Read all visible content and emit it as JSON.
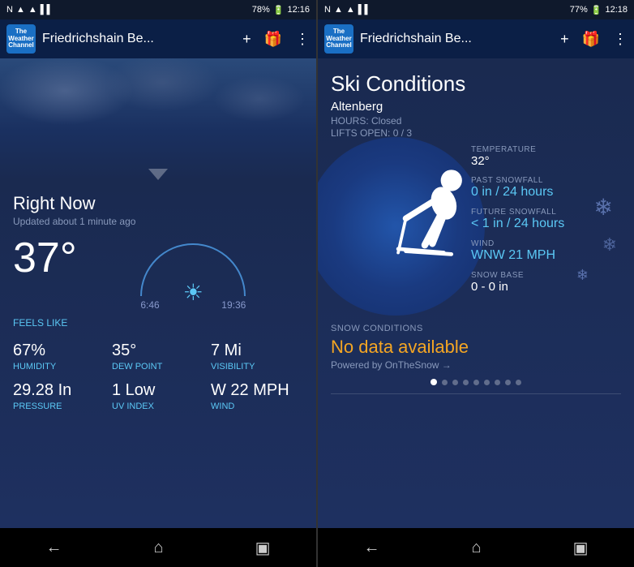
{
  "left_panel": {
    "status_bar": {
      "left_icons": [
        "NFC",
        "signal",
        "wifi",
        "signal-bars"
      ],
      "battery": "78%",
      "time": "12:16"
    },
    "app_bar": {
      "logo_line1": "The",
      "logo_line2": "Weather",
      "logo_line3": "Channel",
      "title": "Friedrichshain Be...",
      "add_icon": "+",
      "gift_icon": "🎁",
      "more_icon": "⋮"
    },
    "right_now": {
      "title": "Right Now",
      "updated": "Updated about 1 minute ago",
      "temperature": "37°",
      "feels_like": "FEELS LIKE",
      "sunrise": "6:46",
      "sunset": "19:36"
    },
    "stats": [
      {
        "value": "67%",
        "label": "HUMIDITY"
      },
      {
        "value": "35°",
        "label": "DEW POINT"
      },
      {
        "value": "7 Mi",
        "label": "VISIBILITY"
      },
      {
        "value": "29.28 In",
        "label": "PRESSURE"
      },
      {
        "value": "1 Low",
        "label": "UV INDEX"
      },
      {
        "value": "W 22 MPH",
        "label": "WIND"
      }
    ]
  },
  "right_panel": {
    "status_bar": {
      "battery": "77%",
      "time": "12:18"
    },
    "app_bar": {
      "logo_line1": "The",
      "logo_line2": "Weather",
      "logo_line3": "Channel",
      "title": "Friedrichshain Be...",
      "add_icon": "+",
      "gift_icon": "🎁",
      "more_icon": "⋮"
    },
    "ski": {
      "title": "Ski Conditions",
      "resort": "Altenberg",
      "hours_label": "HOURS:",
      "hours_value": "Closed",
      "lifts_label": "LIFTS OPEN:",
      "lifts_value": "0 / 3",
      "stats": [
        {
          "label": "TEMPERATURE",
          "value": "32°",
          "highlight": false
        },
        {
          "label": "PAST SNOWFALL",
          "value": "0 in / 24 hours",
          "highlight": true
        },
        {
          "label": "FUTURE SNOWFALL",
          "value": "< 1 in / 24 hours",
          "highlight": true
        },
        {
          "label": "WIND",
          "value": "WNW 21 MPH",
          "highlight": true
        },
        {
          "label": "SNOW BASE",
          "value": "0 - 0 in",
          "highlight": false
        }
      ],
      "snow_conditions_label": "SNOW CONDITIONS",
      "snow_conditions_value": "No data available",
      "powered_by": "Powered by OnTheSnow →"
    },
    "pagination": {
      "total": 9,
      "active": 0
    }
  },
  "nav": {
    "back": "←",
    "home": "⌂",
    "recents": "▣"
  }
}
